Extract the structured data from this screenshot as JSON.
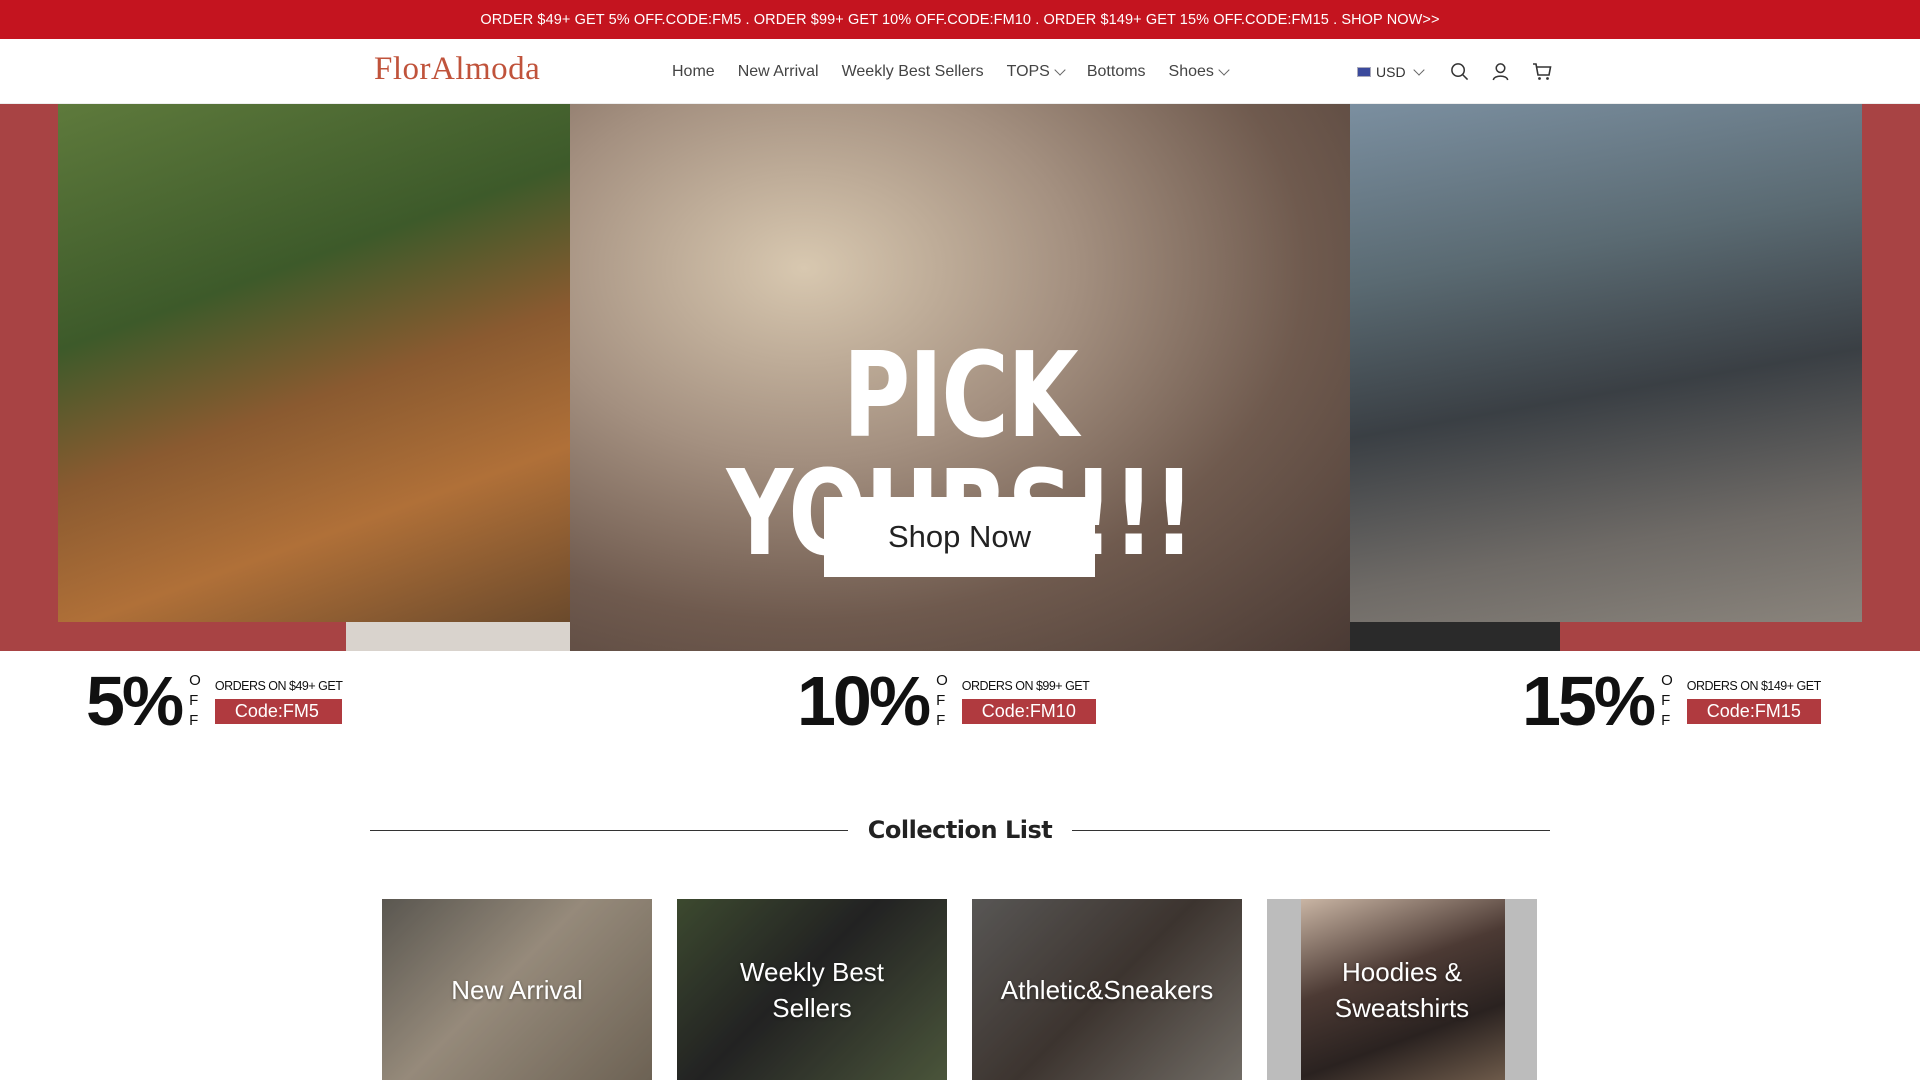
{
  "announcement": "ORDER $49+ GET 5% OFF.CODE:FM5 . ORDER $99+ GET 10% OFF.CODE:FM10 . ORDER $149+ GET 15% OFF.CODE:FM15 . SHOP NOW>>",
  "header": {
    "logo": "FlorAlmoda",
    "nav": [
      {
        "label": "Home",
        "dropdown": false
      },
      {
        "label": "New Arrival",
        "dropdown": false
      },
      {
        "label": "Weekly Best Sellers",
        "dropdown": false
      },
      {
        "label": "TOPS",
        "dropdown": true
      },
      {
        "label": "Bottoms",
        "dropdown": false
      },
      {
        "label": "Shoes",
        "dropdown": true
      }
    ],
    "currency": "USD",
    "icons": [
      "search-icon",
      "account-icon",
      "cart-icon"
    ]
  },
  "hero": {
    "title": "PICK YOURS!!!",
    "button": "Shop Now",
    "accent_color": "#a84344"
  },
  "discounts": [
    {
      "percent": "5%",
      "off": [
        "O",
        "F",
        "F"
      ],
      "orders": "ORDERS ON $49+ GET",
      "code": "Code:FM5"
    },
    {
      "percent": "10%",
      "off": [
        "O",
        "F",
        "F"
      ],
      "orders": "ORDERS ON $99+ GET",
      "code": "Code:FM10"
    },
    {
      "percent": "15%",
      "off": [
        "O",
        "F",
        "F"
      ],
      "orders": "ORDERS ON $149+ GET",
      "code": "Code:FM15"
    }
  ],
  "collection": {
    "title": "Collection List",
    "cards": [
      {
        "label": "New Arrival"
      },
      {
        "label": "Weekly Best Sellers"
      },
      {
        "label": "Athletic&Sneakers"
      },
      {
        "label": "Hoodies & Sweatshirts"
      }
    ]
  },
  "colors": {
    "brand_red": "#c4141f",
    "logo": "#c0533b",
    "code_bg": "#b03a3f"
  }
}
